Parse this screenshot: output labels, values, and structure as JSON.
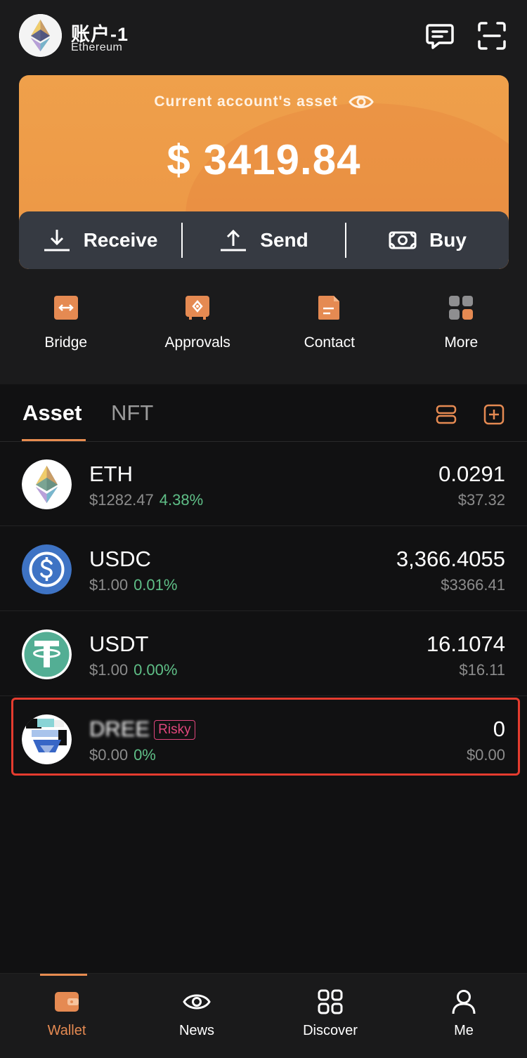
{
  "header": {
    "account_name": "账户-1",
    "network": "Ethereum",
    "chat_icon": "chat-icon",
    "scan_icon": "scan-icon"
  },
  "asset_card": {
    "label": "Current account's asset",
    "total": "$ 3419.84",
    "actions": [
      {
        "label": "Receive",
        "icon": "download-icon"
      },
      {
        "label": "Send",
        "icon": "upload-icon"
      },
      {
        "label": "Buy",
        "icon": "cash-icon"
      }
    ]
  },
  "quick_actions": [
    {
      "label": "Bridge",
      "icon": "bridge-icon"
    },
    {
      "label": "Approvals",
      "icon": "approvals-icon"
    },
    {
      "label": "Contact",
      "icon": "contact-icon"
    },
    {
      "label": "More",
      "icon": "more-grid-icon"
    }
  ],
  "tabs": {
    "asset": "Asset",
    "nft": "NFT"
  },
  "tokens": [
    {
      "symbol": "ETH",
      "price": "$1282.47",
      "change": "4.38%",
      "amount": "0.0291",
      "value": "$37.32",
      "risky": ""
    },
    {
      "symbol": "USDC",
      "price": "$1.00",
      "change": "0.01%",
      "amount": "3,366.4055",
      "value": "$3366.41",
      "risky": ""
    },
    {
      "symbol": "USDT",
      "price": "$1.00",
      "change": "0.00%",
      "amount": "16.1074",
      "value": "$16.11",
      "risky": ""
    },
    {
      "symbol": "DREE",
      "price": "$0.00",
      "change": "0%",
      "amount": "0",
      "value": "$0.00",
      "risky": "Risky"
    }
  ],
  "nav": [
    {
      "label": "Wallet",
      "icon": "wallet-icon",
      "active": true
    },
    {
      "label": "News",
      "icon": "eye-icon",
      "active": false
    },
    {
      "label": "Discover",
      "icon": "discover-icon",
      "active": false
    },
    {
      "label": "Me",
      "icon": "person-icon",
      "active": false
    }
  ],
  "colors": {
    "accent": "#e78c50",
    "card": "#ec9645",
    "positive": "#5fbf87",
    "risky": "#e0467c",
    "highlight": "#e53c2f"
  }
}
